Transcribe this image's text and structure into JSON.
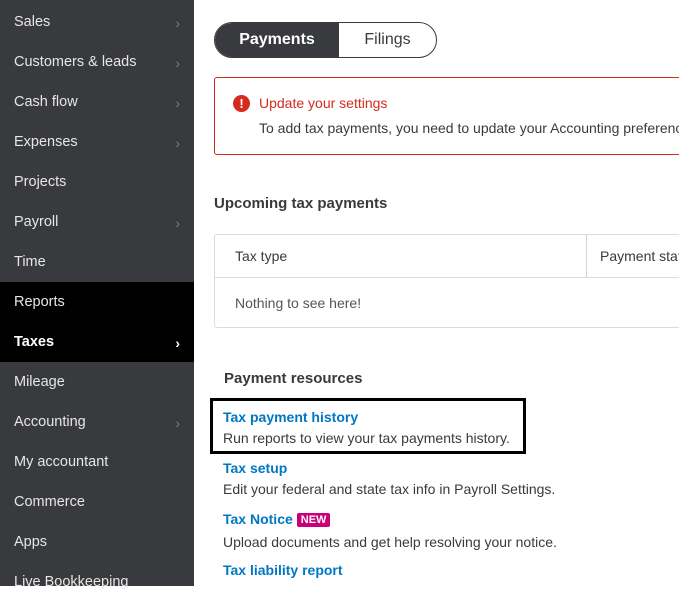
{
  "sidebar": {
    "items": [
      {
        "label": "Sales",
        "chevron": true
      },
      {
        "label": "Customers & leads",
        "chevron": true
      },
      {
        "label": "Cash flow",
        "chevron": true
      },
      {
        "label": "Expenses",
        "chevron": true
      },
      {
        "label": "Projects",
        "chevron": false
      },
      {
        "label": "Payroll",
        "chevron": true
      },
      {
        "label": "Time",
        "chevron": false
      },
      {
        "label": "Reports",
        "chevron": false
      },
      {
        "label": "Taxes",
        "chevron": true
      },
      {
        "label": "Mileage",
        "chevron": false
      },
      {
        "label": "Accounting",
        "chevron": true
      },
      {
        "label": "My accountant",
        "chevron": false
      },
      {
        "label": "Commerce",
        "chevron": false
      },
      {
        "label": "Apps",
        "chevron": false
      },
      {
        "label": "Live Bookkeeping",
        "chevron": false
      }
    ],
    "active": "Taxes",
    "chevron_glyph": "›"
  },
  "tabs": {
    "payments": "Payments",
    "filings": "Filings"
  },
  "alert": {
    "icon": "!",
    "title": "Update your settings",
    "message": "To add tax payments, you need to update your Accounting preferences."
  },
  "upcoming": {
    "title": "Upcoming tax payments",
    "columns": [
      "Tax type",
      "Payment status"
    ],
    "empty": "Nothing to see here!"
  },
  "resources": {
    "title": "Payment resources",
    "items": [
      {
        "link": "Tax payment history",
        "desc": "Run reports to view your tax payments history."
      },
      {
        "link": "Tax setup",
        "desc": "Edit your federal and state tax info in Payroll Settings."
      },
      {
        "link": "Tax Notice",
        "badge": "NEW",
        "desc": "Upload documents and get help resolving your notice."
      },
      {
        "link": "Tax liability report",
        "desc": ""
      }
    ]
  }
}
